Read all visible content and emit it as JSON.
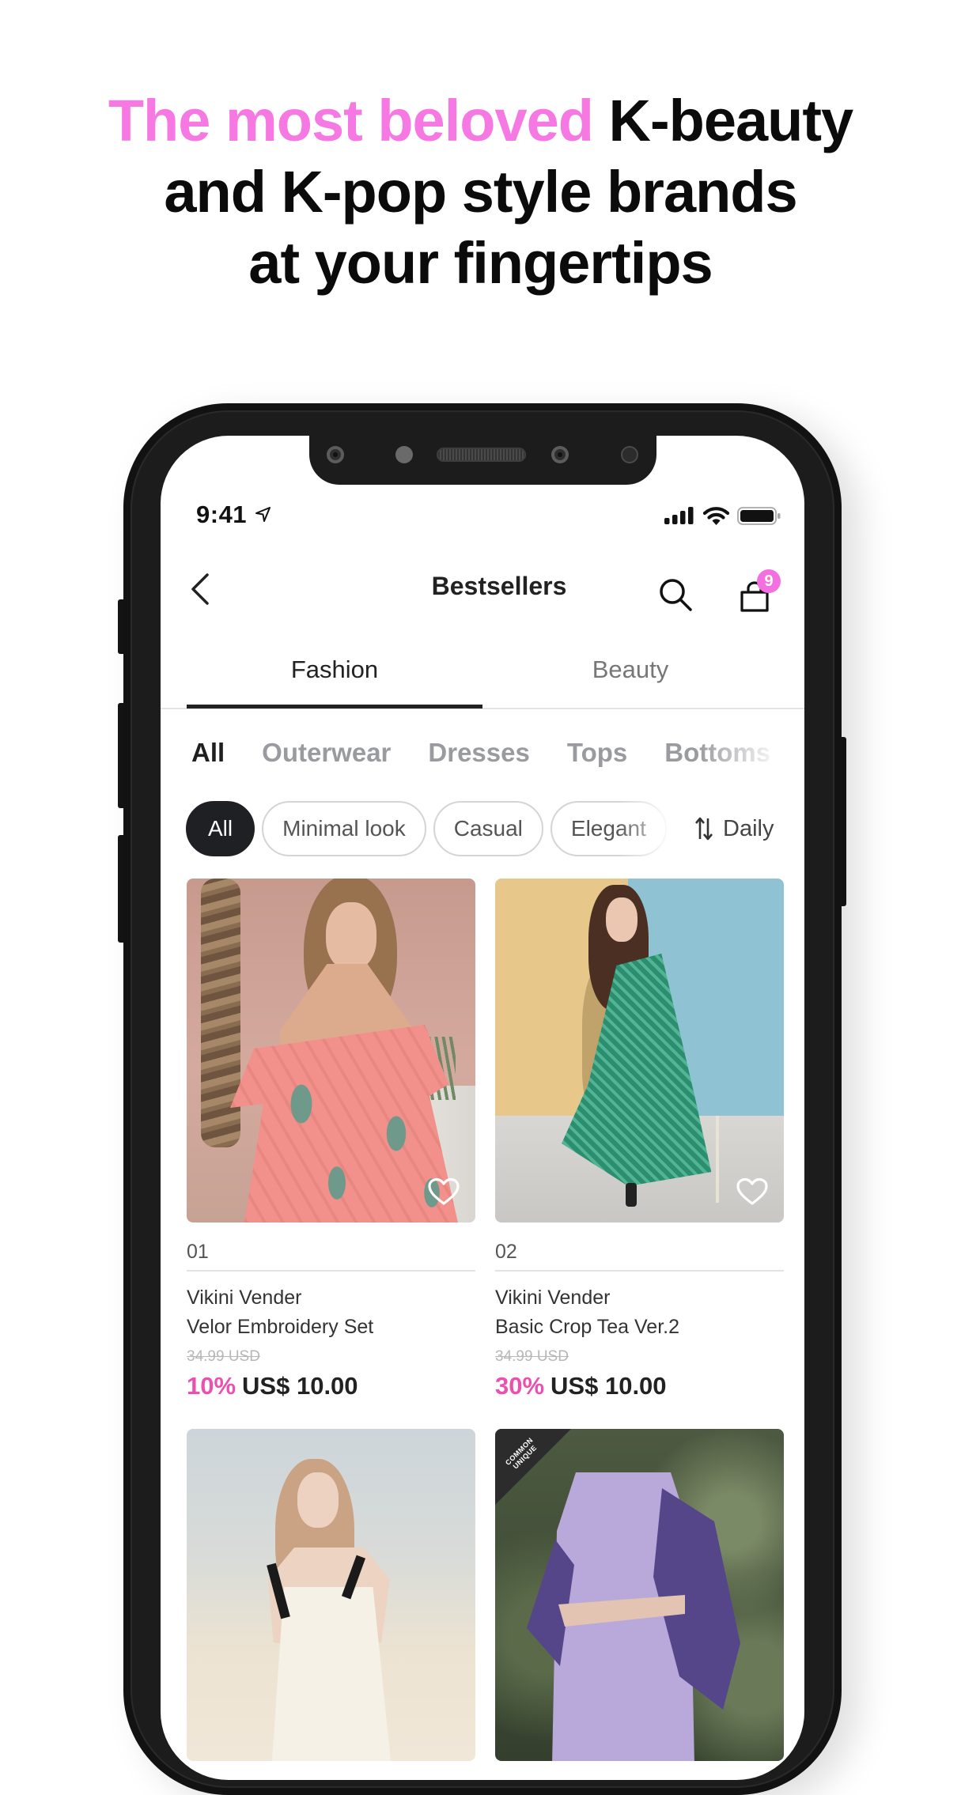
{
  "headline": {
    "highlight": "The most beloved",
    "line1_rest": " K-beauty",
    "line2": "and K-pop style brands",
    "line3": "at your fingertips",
    "highlight_color": "#F578E3"
  },
  "status_bar": {
    "time": "9:41",
    "icons": [
      "location-arrow-icon",
      "cellular-signal-icon",
      "wifi-icon",
      "battery-icon"
    ]
  },
  "nav": {
    "title": "Bestsellers",
    "back_icon": "chevron-left-icon",
    "search_icon": "search-icon",
    "cart_icon": "shopping-bag-icon",
    "cart_badge": "9",
    "badge_color": "#F46FE0"
  },
  "tabs": [
    {
      "label": "Fashion",
      "active": true
    },
    {
      "label": "Beauty",
      "active": false
    }
  ],
  "categories": [
    {
      "label": "All",
      "active": true
    },
    {
      "label": "Outerwear",
      "active": false
    },
    {
      "label": "Dresses",
      "active": false
    },
    {
      "label": "Tops",
      "active": false
    },
    {
      "label": "Bottoms",
      "active": false
    }
  ],
  "filters": {
    "chips": [
      {
        "label": "All",
        "active": true
      },
      {
        "label": "Minimal look",
        "active": false
      },
      {
        "label": "Casual",
        "active": false
      },
      {
        "label": "Elegant",
        "active": false
      }
    ],
    "sort_icon": "sort-arrows-icon",
    "sort_label": "Daily"
  },
  "products": [
    {
      "rank": "01",
      "brand": "Vikini Vender",
      "name": "Velor Embroidery Set",
      "original_price": "34.99 USD",
      "discount": "10%",
      "price": "US$ 10.00",
      "liked": false
    },
    {
      "rank": "02",
      "brand": "Vikini Vender",
      "name": "Basic Crop Tea Ver.2",
      "original_price": "34.99 USD",
      "discount": "30%",
      "price": "US$ 10.00",
      "liked": false
    },
    {
      "image_badge": ""
    },
    {
      "image_badge": "COMMON UNIQUE"
    }
  ],
  "colors": {
    "accent_pink": "#F578E3",
    "discount_pink": "#EC4FAE",
    "chip_active": "#1F2024",
    "text_primary": "#222222",
    "text_muted": "#9A9B9F"
  }
}
